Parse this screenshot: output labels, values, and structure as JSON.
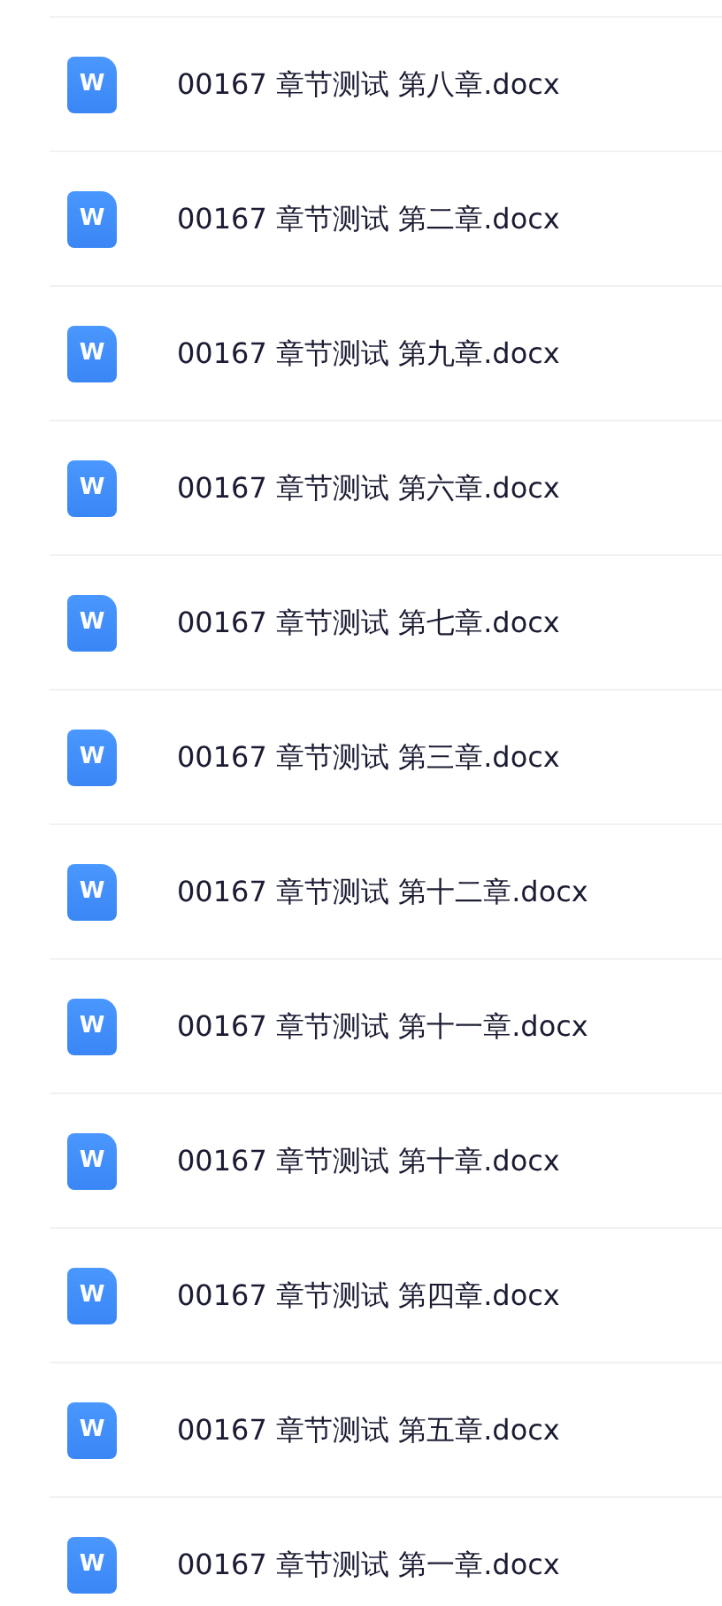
{
  "files": [
    {
      "name": "00167 章节测试 第八章.docx",
      "icon_letter": "W"
    },
    {
      "name": "00167 章节测试 第二章.docx",
      "icon_letter": "W"
    },
    {
      "name": "00167 章节测试 第九章.docx",
      "icon_letter": "W"
    },
    {
      "name": "00167 章节测试 第六章.docx",
      "icon_letter": "W"
    },
    {
      "name": "00167 章节测试 第七章.docx",
      "icon_letter": "W"
    },
    {
      "name": "00167 章节测试 第三章.docx",
      "icon_letter": "W"
    },
    {
      "name": "00167 章节测试 第十二章.docx",
      "icon_letter": "W"
    },
    {
      "name": "00167 章节测试 第十一章.docx",
      "icon_letter": "W"
    },
    {
      "name": "00167 章节测试 第十章.docx",
      "icon_letter": "W"
    },
    {
      "name": "00167 章节测试 第四章.docx",
      "icon_letter": "W"
    },
    {
      "name": "00167 章节测试 第五章.docx",
      "icon_letter": "W"
    },
    {
      "name": "00167 章节测试 第一章.docx",
      "icon_letter": "W"
    }
  ]
}
